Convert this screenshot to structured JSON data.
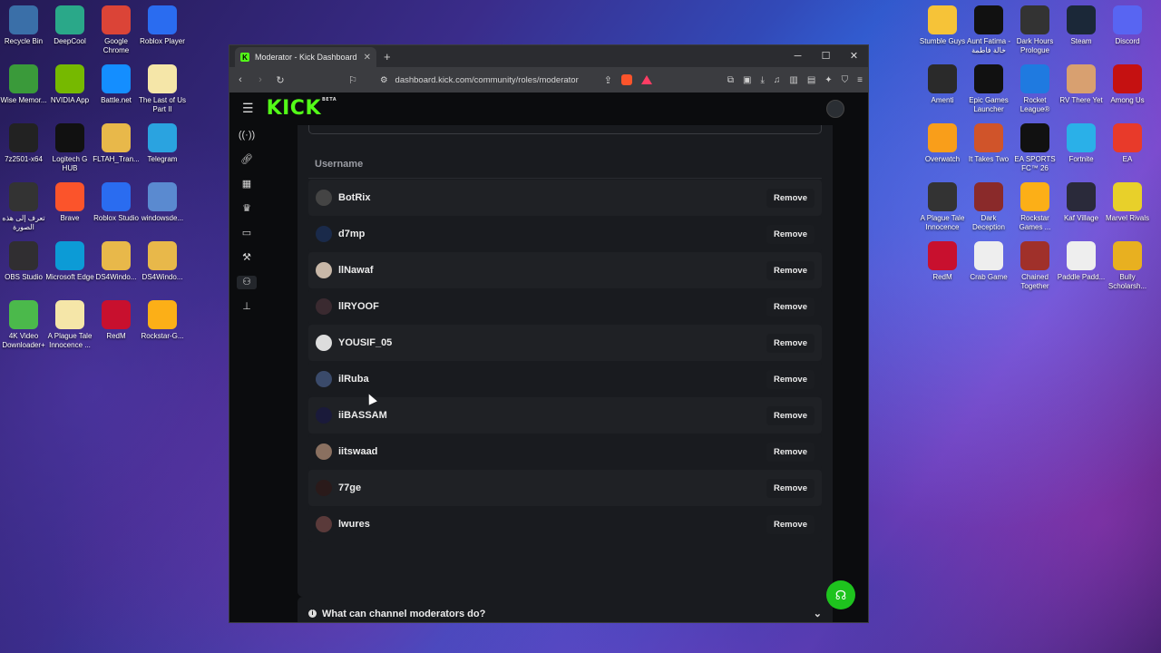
{
  "desktop": {
    "left_icons": [
      {
        "label": "Recycle Bin",
        "color": "#3a6fa8"
      },
      {
        "label": "DeepCool",
        "color": "#2aa889"
      },
      {
        "label": "Google Chrome",
        "color": "#db4437"
      },
      {
        "label": "Roblox Player",
        "color": "#2a6cf0"
      },
      {
        "label": "Wise Memor...",
        "color": "#3a9a3a"
      },
      {
        "label": "NVIDIA App",
        "color": "#76b900"
      },
      {
        "label": "Battle.net",
        "color": "#148eff"
      },
      {
        "label": "The Last of Us Part II",
        "color": "#f5e6a8"
      },
      {
        "label": "7z2501-x64",
        "color": "#222"
      },
      {
        "label": "Logitech G HUB",
        "color": "#111"
      },
      {
        "label": "FLTAH_Tran...",
        "color": "#e8b84a"
      },
      {
        "label": "Telegram",
        "color": "#2aa3e0"
      },
      {
        "label": "تعرف إلى هذه الصورة",
        "color": "#333"
      },
      {
        "label": "Brave",
        "color": "#fb542b"
      },
      {
        "label": "Roblox Studio",
        "color": "#2a6cf0"
      },
      {
        "label": "windowsde...",
        "color": "#5a8ad0"
      },
      {
        "label": "OBS Studio",
        "color": "#302e31"
      },
      {
        "label": "Microsoft Edge",
        "color": "#0c9bd6"
      },
      {
        "label": "DS4Windo...",
        "color": "#e8b84a"
      },
      {
        "label": "DS4Windo...",
        "color": "#e8b84a"
      },
      {
        "label": "4K Video Downloader+",
        "color": "#4bb94b"
      },
      {
        "label": "A Plague Tale Innocence ...",
        "color": "#f5e6a8"
      },
      {
        "label": "RedM",
        "color": "#c8102e"
      },
      {
        "label": "Rockstar-G...",
        "color": "#fcaf17"
      }
    ],
    "right_icons": [
      {
        "label": "Stumble Guys",
        "color": "#f6c338"
      },
      {
        "label": "Aunt Fatima - خالة فاطمة",
        "color": "#111"
      },
      {
        "label": "Dark Hours Prologue",
        "color": "#333"
      },
      {
        "label": "Steam",
        "color": "#1b2838"
      },
      {
        "label": "Discord",
        "color": "#5865f2"
      },
      {
        "label": "Amenti",
        "color": "#2a2a2a"
      },
      {
        "label": "Epic Games Launcher",
        "color": "#111"
      },
      {
        "label": "Rocket League®",
        "color": "#1f7ae0"
      },
      {
        "label": "RV There Yet",
        "color": "#d8a070"
      },
      {
        "label": "Among Us",
        "color": "#c51111"
      },
      {
        "label": "Overwatch",
        "color": "#f99e1a"
      },
      {
        "label": "It Takes Two",
        "color": "#d0542a"
      },
      {
        "label": "EA SPORTS FC™ 26",
        "color": "#111"
      },
      {
        "label": "Fortnite",
        "color": "#2ab0e8"
      },
      {
        "label": "EA",
        "color": "#e83a2a"
      },
      {
        "label": "A Plague Tale Innocence",
        "color": "#333"
      },
      {
        "label": "Dark Deception",
        "color": "#8a2a2a"
      },
      {
        "label": "Rockstar Games ...",
        "color": "#fcaf17"
      },
      {
        "label": "Kaf Village",
        "color": "#2a2a3a"
      },
      {
        "label": "Marvel Rivals",
        "color": "#e8d02a"
      },
      {
        "label": "RedM",
        "color": "#c8102e"
      },
      {
        "label": "Crab Game",
        "color": "#eee"
      },
      {
        "label": "Chained Together",
        "color": "#a0302a"
      },
      {
        "label": "Paddle Padd...",
        "color": "#eee"
      },
      {
        "label": "Bully Scholarsh...",
        "color": "#e8b020"
      }
    ]
  },
  "browser": {
    "tab_title": "Moderator - Kick Dashboard",
    "tab_favicon": "K",
    "url": "dashboard.kick.com/community/roles/moderator",
    "win_controls": [
      "─",
      "☐",
      "✕"
    ]
  },
  "kick": {
    "logo": "KICK",
    "logo_badge": "BETA",
    "column_header": "Username",
    "remove_label": "Remove",
    "moderators": [
      {
        "username": "BotRix",
        "avatar_color": "#444"
      },
      {
        "username": "d7mp",
        "avatar_color": "#1a2a4a"
      },
      {
        "username": "llNawaf",
        "avatar_color": "#c8b8a8"
      },
      {
        "username": "llRYOOF",
        "avatar_color": "#3a2a30"
      },
      {
        "username": "YOUSIF_05",
        "avatar_color": "#ddd"
      },
      {
        "username": "ilRuba",
        "avatar_color": "#3a4a6a"
      },
      {
        "username": "iiBASSAM",
        "avatar_color": "#1a1a3a"
      },
      {
        "username": "iitswaad",
        "avatar_color": "#8a7060"
      },
      {
        "username": "77ge",
        "avatar_color": "#2a1a1a"
      },
      {
        "username": "lwures",
        "avatar_color": "#5a3a3a"
      }
    ],
    "faq_question": "What can channel moderators do?"
  }
}
